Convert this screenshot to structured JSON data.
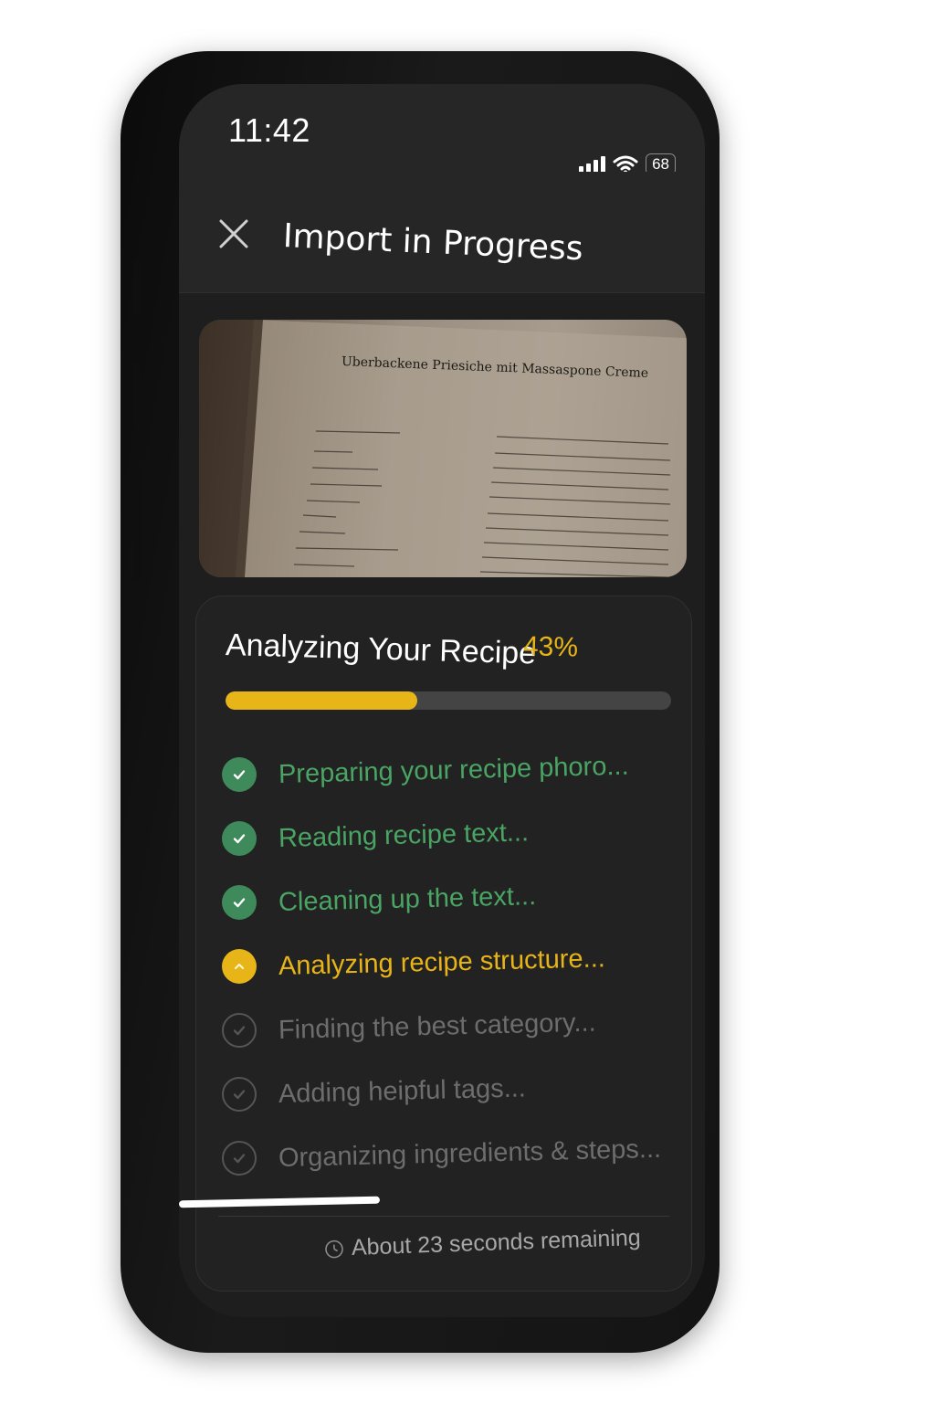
{
  "status_bar": {
    "time": "11:42",
    "battery": "68",
    "icons": [
      "signal-icon",
      "wifi-icon",
      "battery-icon"
    ]
  },
  "header": {
    "title": "Import in Progress",
    "close_icon": "close-icon"
  },
  "photo": {
    "recipe_title": "Uberbackene Priesiche mit Massaspone Creme"
  },
  "progress_card": {
    "title": "Analyzing Your Recipe",
    "percent_label": "43%",
    "progress": 0.43,
    "steps": [
      {
        "label": "Preparing your recipe phoro...",
        "state": "done"
      },
      {
        "label": "Reading recipe text...",
        "state": "done"
      },
      {
        "label": "Cleaning up the text...",
        "state": "done"
      },
      {
        "label": "Analyzing recipe structure...",
        "state": "active"
      },
      {
        "label": "Finding the best category...",
        "state": "pending"
      },
      {
        "label": "Adding heipful tags...",
        "state": "pending"
      },
      {
        "label": "Organizing ingredients & steps...",
        "state": "pending"
      }
    ],
    "remaining": "About 23 seconds remaining"
  },
  "colors": {
    "accent": "#e8b518",
    "done": "#4aa564",
    "pending": "#6d6d6d",
    "background": "#1e1e1e"
  }
}
